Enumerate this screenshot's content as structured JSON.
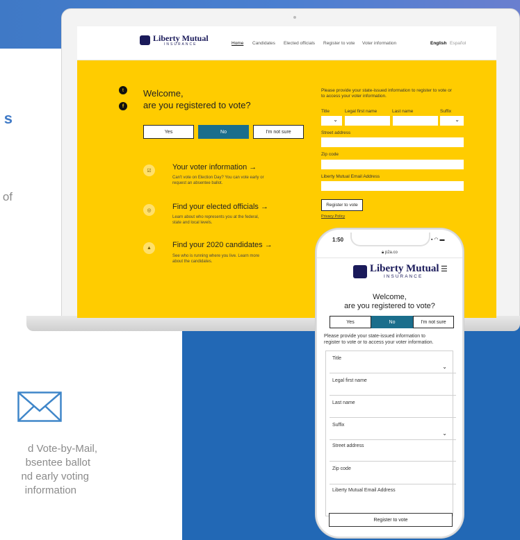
{
  "side": {
    "text_of": "of",
    "lines": [
      "d Vote-by-Mail,",
      "bsentee ballot",
      "nd early voting",
      "information"
    ]
  },
  "brand": {
    "name": "Liberty Mutual",
    "sub": "INSURANCE"
  },
  "nav": {
    "items": [
      "Home",
      "Candidates",
      "Elected officials",
      "Register to vote",
      "Voter information"
    ],
    "lang_en": "English",
    "lang_es": "Español"
  },
  "desktop": {
    "welcome": "Welcome,",
    "question": "are you registered to vote?",
    "buttons": {
      "yes": "Yes",
      "no": "No",
      "unsure": "I'm not sure"
    },
    "features": [
      {
        "title": "Your voter information  →",
        "desc1": "Can't vote on Election Day? You can vote early or",
        "desc2": "request an absentee ballot."
      },
      {
        "title": "Find your elected officials  →",
        "desc1": "Learn about who represents you at the federal,",
        "desc2": "state and local levels."
      },
      {
        "title": "Find your 2020 candidates  →",
        "desc1": "See who is running where you live. Learn more",
        "desc2": "about the candidates."
      }
    ],
    "form": {
      "intro1": "Please provide your state-issued information to register to vote or",
      "intro2": "to access your voter information.",
      "title": "Title",
      "first": "Legal first name",
      "last": "Last name",
      "suffix": "Suffix",
      "street": "Street address",
      "zip": "Zip code",
      "email": "Liberty Mutual Email Address",
      "submit": "Register to vote",
      "privacy": "Privacy Policy"
    }
  },
  "mobile": {
    "time": "1:50",
    "url": "p2a.co",
    "welcome": "Welcome,",
    "question": "are you registered to vote?",
    "buttons": {
      "yes": "Yes",
      "no": "No",
      "unsure": "I'm not sure"
    },
    "intro1": "Please provide your state-issued information to",
    "intro2": "register to vote or to access your voter information.",
    "fields": [
      "Title",
      "Legal first name",
      "Last name",
      "Suffix",
      "Street address",
      "Zip code",
      "Liberty Mutual Email Address"
    ],
    "submit": "Register to vote"
  },
  "colors": {
    "yellow": "#ffcc00",
    "teal": "#1b6e8c",
    "navy": "#1a1a5a",
    "blue": "#2268b5"
  }
}
